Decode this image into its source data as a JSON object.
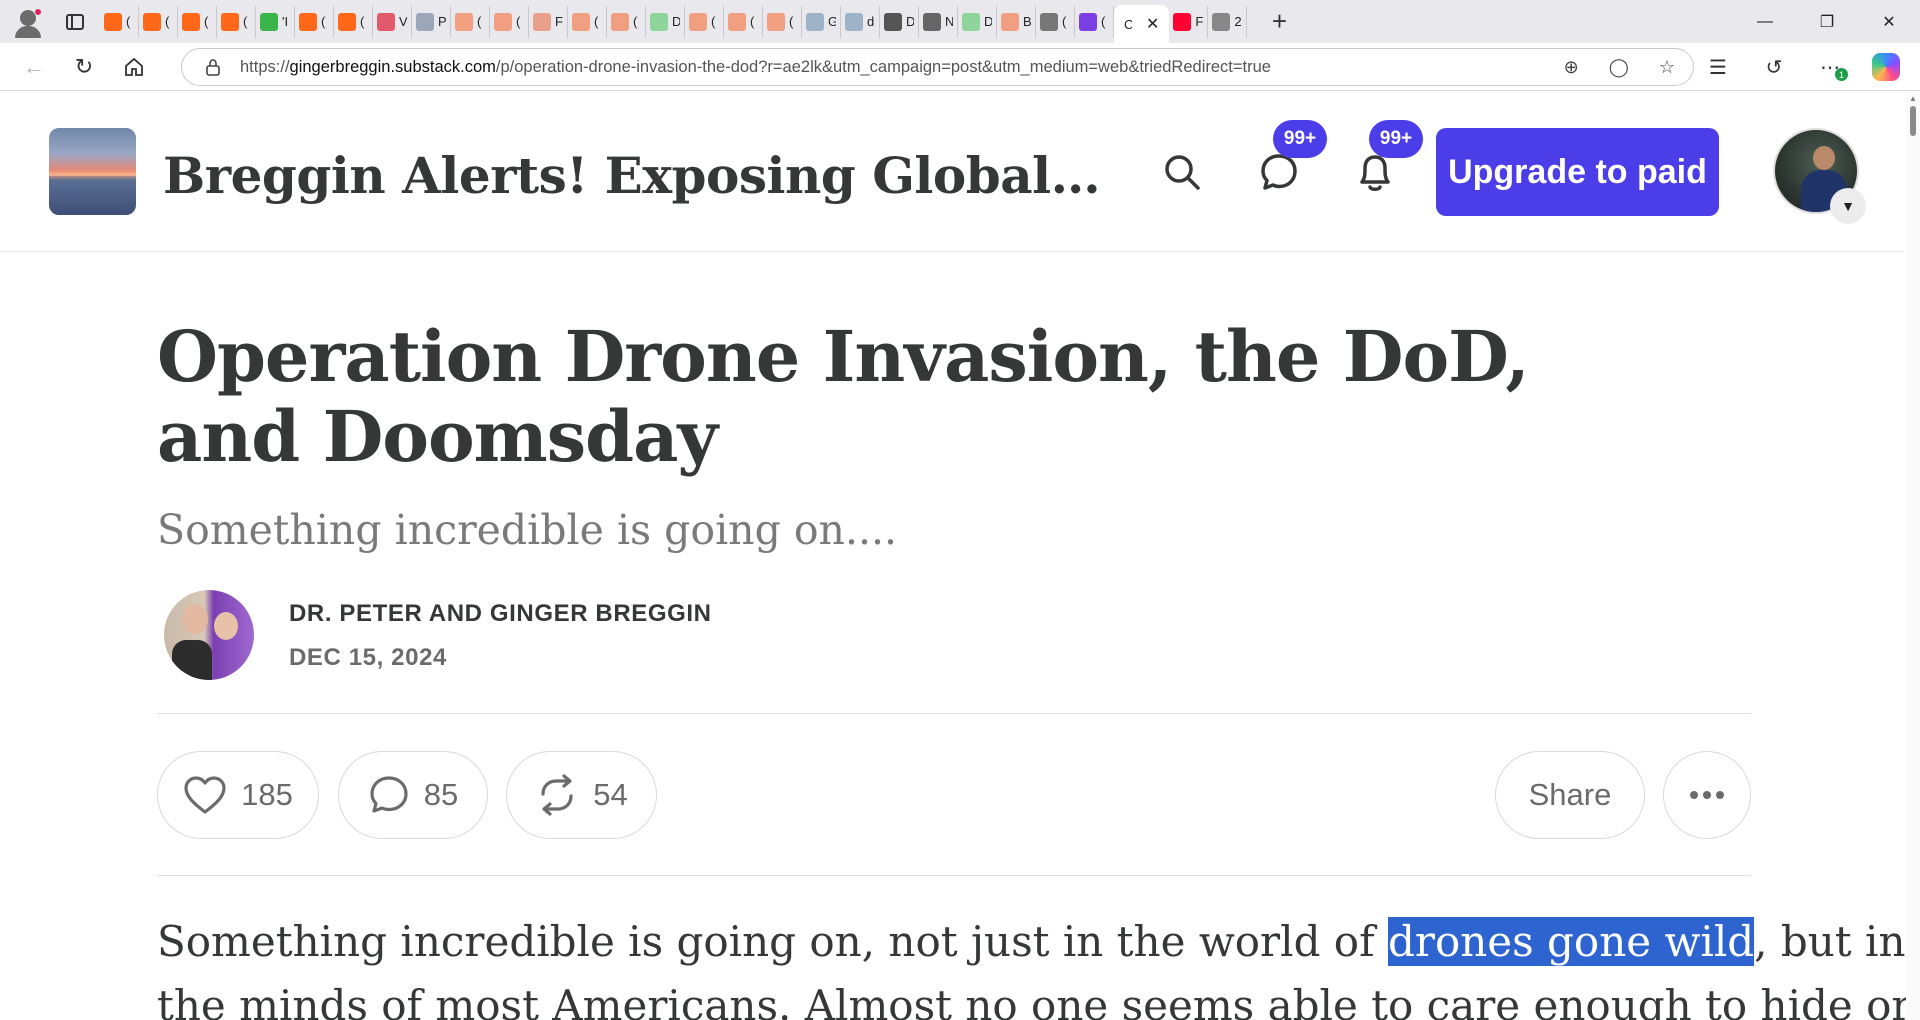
{
  "browser": {
    "tabs": [
      {
        "favicon": "substack-icon",
        "label": "(",
        "color": "#ff6719"
      },
      {
        "favicon": "substack-icon",
        "label": "(",
        "color": "#ff6719"
      },
      {
        "favicon": "substack-icon",
        "label": "(",
        "color": "#ff6719"
      },
      {
        "favicon": "substack-icon",
        "label": "(",
        "color": "#ff6719"
      },
      {
        "favicon": "play-icon",
        "label": "'I",
        "color": "#3bb54a"
      },
      {
        "favicon": "substack-icon",
        "label": "(",
        "color": "#ff6719"
      },
      {
        "favicon": "substack-icon",
        "label": "(",
        "color": "#ff6719"
      },
      {
        "favicon": "youtube-icon",
        "label": "V",
        "color": "#e05a6a"
      },
      {
        "favicon": "gp-icon",
        "label": "P",
        "color": "#9aa7b8"
      },
      {
        "favicon": "substack-icon",
        "label": "(",
        "color": "#f0a080"
      }
    ],
    "pill_tab": "Substack",
    "tabs_after": [
      {
        "favicon": "substack-icon",
        "label": "(",
        "color": "#f0a080"
      },
      {
        "favicon": "page-icon",
        "label": "F",
        "color": "#e8a08a"
      },
      {
        "favicon": "substack-icon",
        "label": "(",
        "color": "#f0a080"
      },
      {
        "favicon": "substack-icon",
        "label": "(",
        "color": "#f0a080"
      },
      {
        "favicon": "play-icon",
        "label": "D",
        "color": "#8fd49a"
      },
      {
        "favicon": "substack-icon",
        "label": "(",
        "color": "#f0a080"
      },
      {
        "favicon": "substack-icon",
        "label": "(",
        "color": "#f0a080"
      },
      {
        "favicon": "substack-icon",
        "label": "(",
        "color": "#f0a080"
      },
      {
        "favicon": "pen-icon",
        "label": "G",
        "color": "#9fb3c8"
      },
      {
        "favicon": "search-icon",
        "label": "d",
        "color": "#9fb3c8"
      },
      {
        "favicon": "slash-icon",
        "label": "D",
        "color": "#555555"
      },
      {
        "favicon": "frame-icon",
        "label": "N",
        "color": "#666666"
      },
      {
        "favicon": "play-icon",
        "label": "D",
        "color": "#8fd49a"
      },
      {
        "favicon": "box-icon",
        "label": "B",
        "color": "#f0a080"
      },
      {
        "favicon": "ring-icon",
        "label": "(",
        "color": "#777777"
      },
      {
        "favicon": "mail-icon",
        "label": "(",
        "color": "#7b3fe4"
      }
    ],
    "active_tab_label": "C",
    "tabs_end": [
      {
        "favicon": "youtube-icon",
        "label": "F",
        "color": "#ff0033"
      },
      {
        "favicon": "page-icon",
        "label": "2",
        "color": "#888888"
      }
    ],
    "url_prefix": "https://",
    "url_host": "gingerbreggin.substack.com",
    "url_path": "/p/operation-drone-invasion-the-dod?r=ae2lk&utm_campaign=post&utm_medium=web&triedRedirect=true",
    "extension_badge": "1"
  },
  "site": {
    "title": "Breggin Alerts! Exposing Global Pred...",
    "chat_badge": "99+",
    "notif_badge": "99+",
    "upgrade_label": "Upgrade to paid",
    "accent_color": "#4b3ee8"
  },
  "post": {
    "title": "Operation Drone Invasion, the DoD, and Doomsday",
    "subtitle": "Something incredible is going on....",
    "author": "DR. PETER AND GINGER BREGGIN",
    "date": "DEC 15, 2024",
    "likes": "185",
    "comments": "85",
    "restacks": "54",
    "share_label": "Share",
    "body_line1_before": "Something incredible is going on, not just in the world of ",
    "body_line1_highlight": "drones gone wild",
    "body_line1_after": ", but in",
    "body_line2": "the minds of most Americans. Almost no one seems able to care enough to hide or"
  }
}
